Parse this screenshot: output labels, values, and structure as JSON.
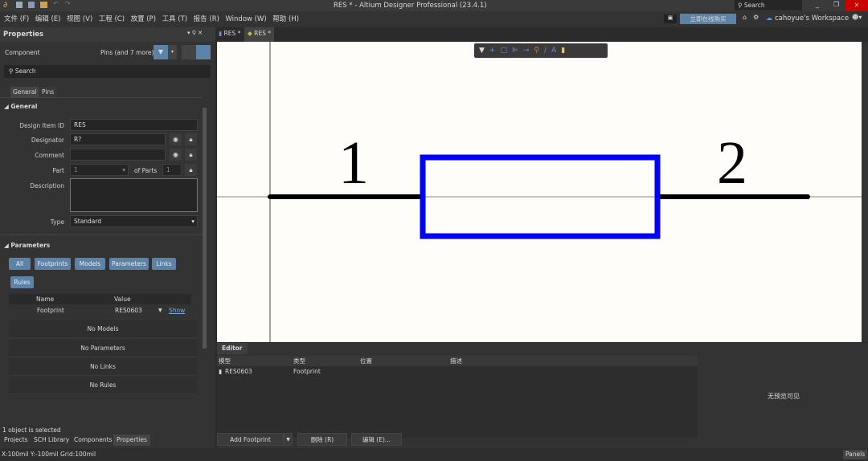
{
  "window": {
    "title": "RES * - Altium Designer Professional (23.4.1)",
    "search_placeholder": "Search",
    "minimize": "_",
    "restore": "❐",
    "close": "✕"
  },
  "menu": [
    "文件 (F)",
    "编辑 (E)",
    "视图 (V)",
    "工程 (C)",
    "放置 (P)",
    "工具 (T)",
    "报告 (R)",
    "Window (W)",
    "帮助 (H)"
  ],
  "header_right": {
    "buy": "立即在线购买",
    "workspace": "cahoyue's Workspace"
  },
  "tabs": [
    {
      "label": "RES *"
    },
    {
      "label": "RES *",
      "active": true
    }
  ],
  "properties": {
    "title": "Properties",
    "object_type": "Component",
    "filter": "Pins (and 7 more)",
    "search_placeholder": "Search",
    "subtabs": [
      "General",
      "Pins"
    ],
    "general_section": "General",
    "fields": {
      "design_item_id_label": "Design Item ID",
      "design_item_id": "RES",
      "designator_label": "Designator",
      "designator": "R?",
      "comment_label": "Comment",
      "comment": "",
      "part_label": "Part",
      "part": "1",
      "of_parts_label": "of Parts",
      "of_parts": "1",
      "description_label": "Description",
      "description": "",
      "type_label": "Type",
      "type": "Standard"
    },
    "parameters_section": "Parameters",
    "param_buttons": [
      "All",
      "Footprints",
      "Models",
      "Parameters",
      "Links",
      "Rules"
    ],
    "table_headers": [
      "Name",
      "Value"
    ],
    "footprint_row": {
      "name": "Footprint",
      "value": "RES0603",
      "link": "Show"
    },
    "empty_rows": [
      "No Models",
      "No Parameters",
      "No Links",
      "No Rules"
    ],
    "status": "1 object is selected"
  },
  "bottom_tabs": [
    "Projects",
    "SCH Library",
    "Components",
    "Properties"
  ],
  "canvas": {
    "pin1": "1",
    "pin2": "2",
    "body_color": "#0000ff",
    "pin_color": "#000000"
  },
  "editor": {
    "title": "Editor",
    "headers": [
      "模型",
      "类型",
      "位置",
      "描述"
    ],
    "rows": [
      {
        "model": "RES0603",
        "type": "Footprint"
      }
    ],
    "preview": "无预览可见",
    "buttons": [
      "Add Footprint",
      "删除 (R)",
      "编辑 (E)..."
    ]
  },
  "statusbar": {
    "coords": "X:100mil Y:-100mil",
    "grid": "Grid:100mil",
    "panels": "Panels"
  }
}
